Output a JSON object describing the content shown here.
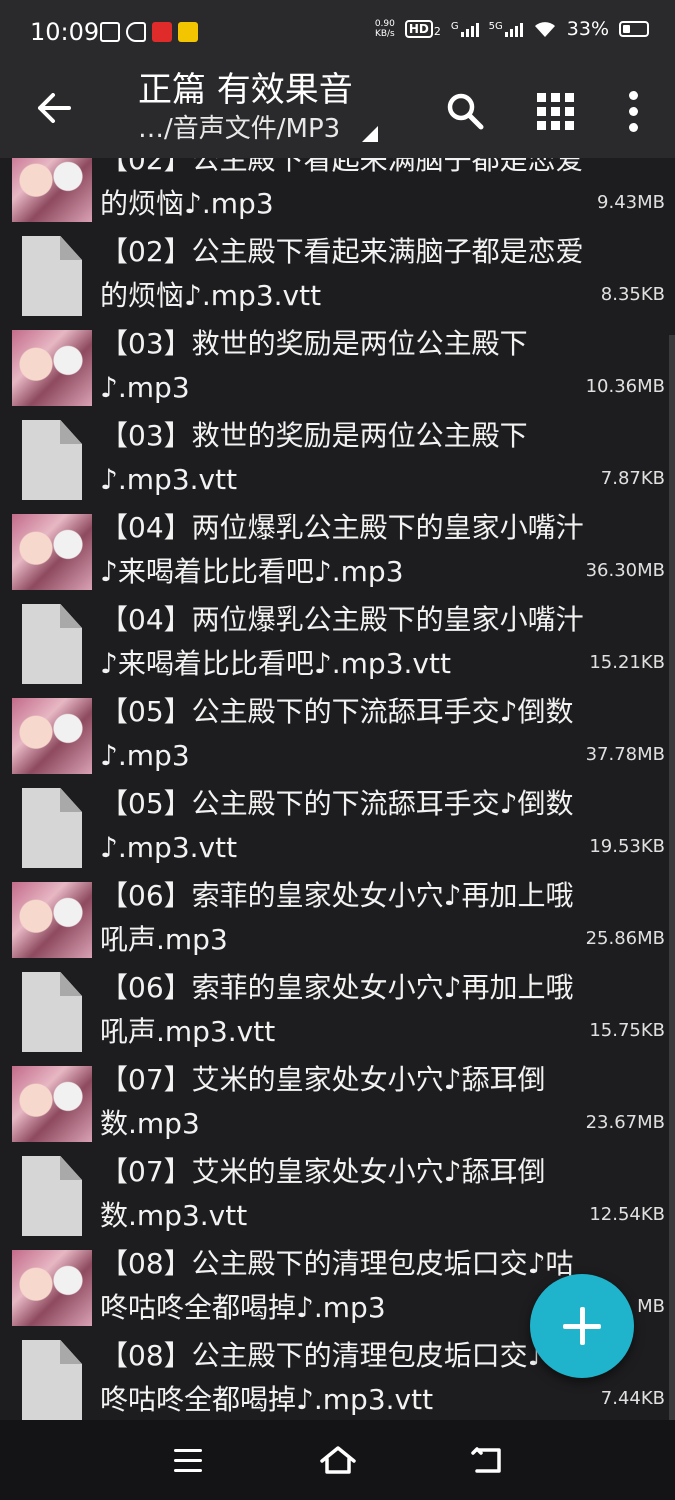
{
  "status_bar": {
    "time": "10:09",
    "net_speed_value": "0.90",
    "net_speed_unit": "KB/s",
    "hd_label": "HD",
    "hd_sub": "2",
    "sig1_label": "G",
    "sig2_label": "5G",
    "battery": "33%"
  },
  "app_bar": {
    "title": "正篇 有效果音",
    "path": "…/音声文件/MP3",
    "back_icon": "arrow-left-icon",
    "search_icon": "search-icon",
    "view_icon": "grid-view-icon",
    "more_icon": "more-vert-icon"
  },
  "files": [
    {
      "name": "【02】公主殿下看起来满脑子都是恋爱的烦恼♪.mp3",
      "size": "9.43MB",
      "type": "audio"
    },
    {
      "name": "【02】公主殿下看起来满脑子都是恋爱的烦恼♪.mp3.vtt",
      "size": "8.35KB",
      "type": "text"
    },
    {
      "name": "【03】救世的奖励是两位公主殿下♪.mp3",
      "size": "10.36MB",
      "type": "audio"
    },
    {
      "name": "【03】救世的奖励是两位公主殿下♪.mp3.vtt",
      "size": "7.87KB",
      "type": "text"
    },
    {
      "name": "【04】两位爆乳公主殿下的皇家小嘴汁♪来喝着比比看吧♪.mp3",
      "size": "36.30MB",
      "type": "audio"
    },
    {
      "name": "【04】两位爆乳公主殿下的皇家小嘴汁♪来喝着比比看吧♪.mp3.vtt",
      "size": "15.21KB",
      "type": "text"
    },
    {
      "name": "【05】公主殿下的下流舔耳手交♪倒数♪.mp3",
      "size": "37.78MB",
      "type": "audio"
    },
    {
      "name": "【05】公主殿下的下流舔耳手交♪倒数♪.mp3.vtt",
      "size": "19.53KB",
      "type": "text"
    },
    {
      "name": "【06】索菲的皇家处女小穴♪再加上哦吼声.mp3",
      "size": "25.86MB",
      "type": "audio"
    },
    {
      "name": "【06】索菲的皇家处女小穴♪再加上哦吼声.mp3.vtt",
      "size": "15.75KB",
      "type": "text"
    },
    {
      "name": "【07】艾米的皇家处女小穴♪舔耳倒数.mp3",
      "size": "23.67MB",
      "type": "audio"
    },
    {
      "name": "【07】艾米的皇家处女小穴♪舔耳倒数.mp3.vtt",
      "size": "12.54KB",
      "type": "text"
    },
    {
      "name": "【08】公主殿下的清理包皮垢口交♪咕咚咕咚全都喝掉♪.mp3",
      "size": "MB",
      "type": "audio"
    },
    {
      "name": "【08】公主殿下的清理包皮垢口交♪咕咚咕咚全都喝掉♪.mp3.vtt",
      "size": "7.44KB",
      "type": "text"
    }
  ],
  "fab": {
    "icon": "plus-icon"
  },
  "nav_bar": {
    "menu_icon": "menu-icon",
    "home_icon": "home-icon",
    "back_icon": "back-icon"
  }
}
